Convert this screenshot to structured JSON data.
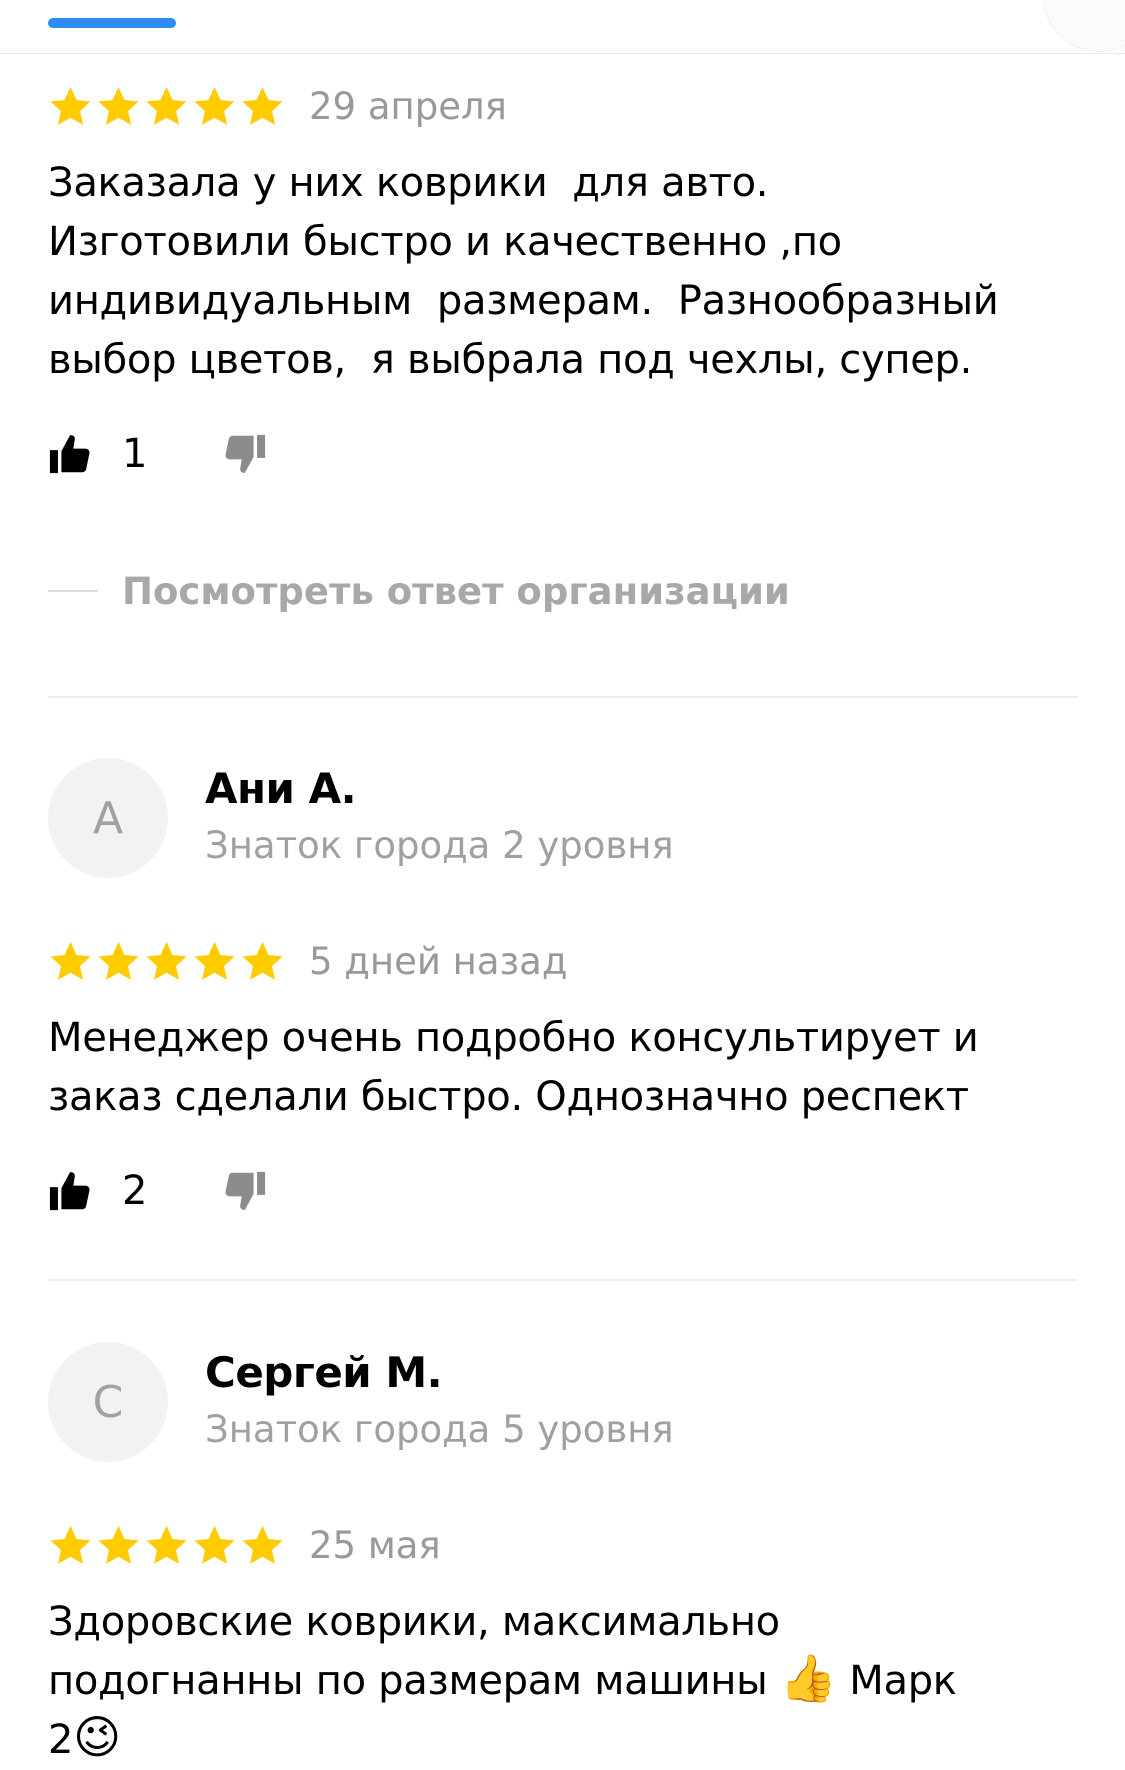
{
  "colors": {
    "accent": "#2d8cf0",
    "star": "#ffcc00",
    "muted": "#a0a0a0"
  },
  "reviews": [
    {
      "date": "29 апреля",
      "rating": 5,
      "text": "Заказала у них коврики  для авто.\nИзготовили быстро и качественно ,по\nиндивидуальным  размерам.  Разнообразный\nвыбор цветов,  я выбрала под чехлы, супер.",
      "likes": "1",
      "org_reply_label": "Посмотреть ответ организации"
    },
    {
      "avatar_letter": "А",
      "author": "Ани А.",
      "level": "Знаток города 2 уровня",
      "date": "5 дней назад",
      "rating": 5,
      "text": "Менеджер очень подробно консультирует и\nзаказ сделали быстро. Однозначно респект",
      "likes": "2"
    },
    {
      "avatar_letter": "С",
      "author": "Сергей М.",
      "level": "Знаток города 5 уровня",
      "date": "25 мая",
      "rating": 5,
      "text_line1": "Здоровские коврики, максимально",
      "text_line2_pre": "подогнанны по размерам машины ",
      "emoji_thumbs": "👍",
      "text_line2_post": " Марк",
      "text_line3_pre": "2",
      "emoji_wink": "😉"
    }
  ]
}
